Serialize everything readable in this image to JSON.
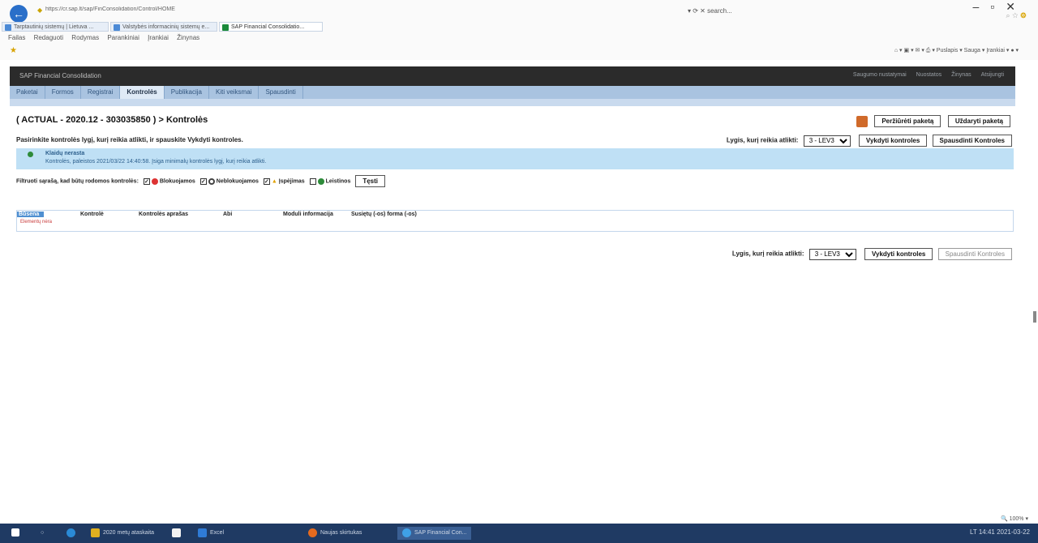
{
  "browser": {
    "url": "https://cr.sap.lt/sap/FinConsolidation/Control/HOME",
    "tabs": [
      "Tarptautinių sistemų | Lietuva ...",
      "Valstybės informacinių sistemų e...",
      "SAP Financial Consolidatio..."
    ],
    "menu": [
      "Failas",
      "Redaguoti",
      "Rodymas",
      "Parankiniai",
      "Įrankiai",
      "Žinynas"
    ],
    "command_bar": [
      "Puslapis ▾",
      "Sauga ▾",
      "Įrankiai ▾"
    ],
    "address_tools": "▾ ⟳ ✕   search..."
  },
  "sap": {
    "app_title": "SAP Financial Consolidation",
    "header_links": [
      "Saugumo nustatymai",
      "Nuostatos",
      "Žinynas",
      "Atsijungti"
    ],
    "tabs": [
      "Paketai",
      "Formos",
      "Registrai",
      "Kontrolės",
      "Publikacija",
      "Kiti veiksmai",
      "Spausdinti"
    ],
    "active_tab": "Kontrolės",
    "page_title": "( ACTUAL - 2020.12 - 303035850 ) > Kontrolės",
    "buttons": {
      "next": "Peržiūrėti paketą",
      "close": "Uždaryti paketą"
    },
    "description": "Pasirinkite kontrolės lygį, kurį reikia atlikti, ir spauskite Vykdyti kontroles.",
    "level_label": "Lygis, kurį reikia atlikti:",
    "level_value": "3 - LEV3",
    "run_controls": "Vykdyti kontroles",
    "print_controls": "Spausdinti Kontroles",
    "status": {
      "title": "Klaidų nerasta",
      "message": "Kontrolės, paleistos 2021/03/22 14:40:58. Įsiga minimalų kontrolės lygį, kurį reikia atlikti."
    },
    "filter": {
      "label": "Filtruoti sąrašą, kad būtų rodomos kontrolės:",
      "blocking": "Blokuojamos",
      "non_blocking": "Neblokuojamos",
      "warnings": "Įspėjimas",
      "ok": "Leistinos",
      "refresh": "Tęsti"
    },
    "table": {
      "columns": [
        "Būsena",
        "Kontrolė",
        "Kontrolės aprašas",
        "Abi",
        "Moduli informacija",
        "Susiętų (-os) forma (-os)"
      ],
      "empty_message": "Elementų nėra"
    }
  },
  "window": {
    "zoom": "100%"
  },
  "taskbar": {
    "items": [
      "2020 metų ataskaita",
      "Excel",
      "Naujas skirtukas",
      "SAP Financial Con..."
    ],
    "tray": "LT  14:41  2021-03-22"
  }
}
